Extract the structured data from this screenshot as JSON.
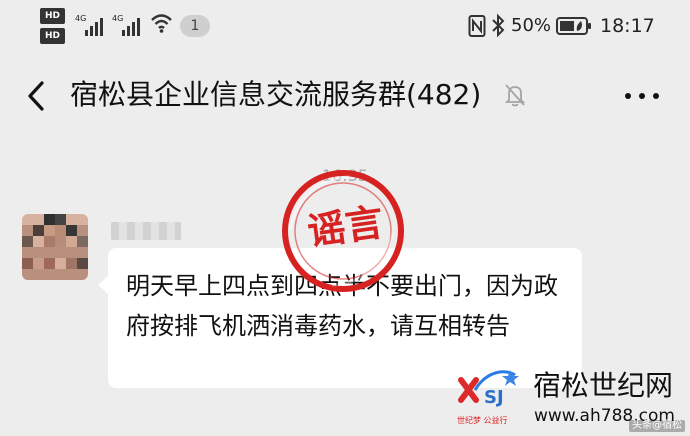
{
  "status_bar": {
    "hd_top": "HD",
    "hd_bottom": "HD",
    "network_1": "4G",
    "network_2": "4G",
    "notification_count": "1",
    "battery_percent": "50%",
    "time": "18:17"
  },
  "nav": {
    "title": "宿松县企业信息交流服务群(482)",
    "back_icon": "chevron-left-icon",
    "mute_icon": "bell-muted-icon",
    "more_icon": "more-icon"
  },
  "chat": {
    "timestamp": "16:35",
    "sender_name": "",
    "message": "明天早上四点到四点半不要出门，因为政府按排飞机洒消毒药水，请互相转告"
  },
  "stamp": {
    "text": "谣言",
    "color": "#d72222"
  },
  "watermark": {
    "logo_name": "xsj-logo",
    "logo_subtitle": "世纪梦 公益行",
    "brand": "宿松世纪网",
    "url": "www.ah788.com",
    "corner_text": "头条@宿松"
  },
  "colors": {
    "background": "#ededed",
    "bubble": "#ffffff",
    "text": "#111111",
    "muted": "#a8a8a8",
    "stamp": "#d72222"
  }
}
